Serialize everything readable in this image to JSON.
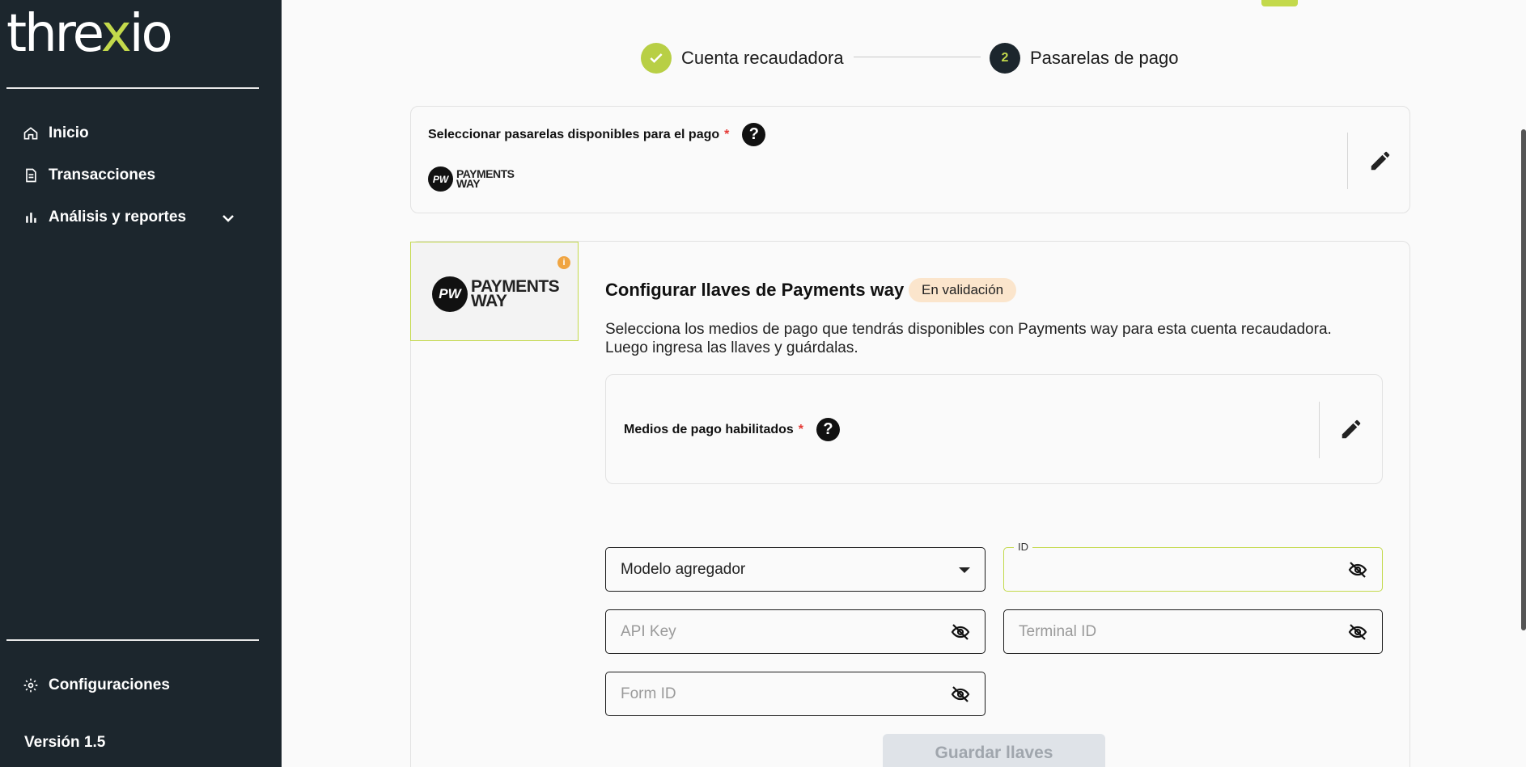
{
  "app": {
    "logo_prefix": "thre",
    "logo_x": "x",
    "logo_suffix": "io"
  },
  "sidebar": {
    "items": [
      {
        "label": "Inicio",
        "icon": "home-icon"
      },
      {
        "label": "Transacciones",
        "icon": "document-icon"
      },
      {
        "label": "Análisis y reportes",
        "icon": "bar-chart-icon"
      }
    ],
    "settings_label": "Configuraciones",
    "version": "Versión 1.5"
  },
  "stepper": {
    "steps": [
      {
        "number": "",
        "label": "Cuenta recaudadora",
        "state": "done"
      },
      {
        "number": "2",
        "label": "Pasarelas de pago",
        "state": "active"
      }
    ]
  },
  "gateways_card": {
    "label": "Seleccionar pasarelas disponibles para el pago",
    "required": "*",
    "help": "?",
    "logo_badge": "PW",
    "logo_line1": "PAYMENTS",
    "logo_line2": "WAY"
  },
  "config": {
    "info": "i",
    "title": "Configurar llaves de Payments way",
    "status": "En validación",
    "description_line1": "Selecciona los medios de pago que tendrás disponibles con Payments way para esta cuenta recaudadora.",
    "description_line2": "Luego ingresa las llaves y guárdalas.",
    "methods_label": "Medios de pago habilitados",
    "required": "*",
    "help": "?"
  },
  "form": {
    "model_select_value": "Modelo agregador",
    "id_label": "ID",
    "api_key_placeholder": "API Key",
    "terminal_id_placeholder": "Terminal ID",
    "form_id_placeholder": "Form ID",
    "save_label": "Guardar llaves"
  },
  "colors": {
    "sidebar": "#1c262d",
    "accent": "#c3d94b",
    "badge": "#fbe5cc"
  }
}
